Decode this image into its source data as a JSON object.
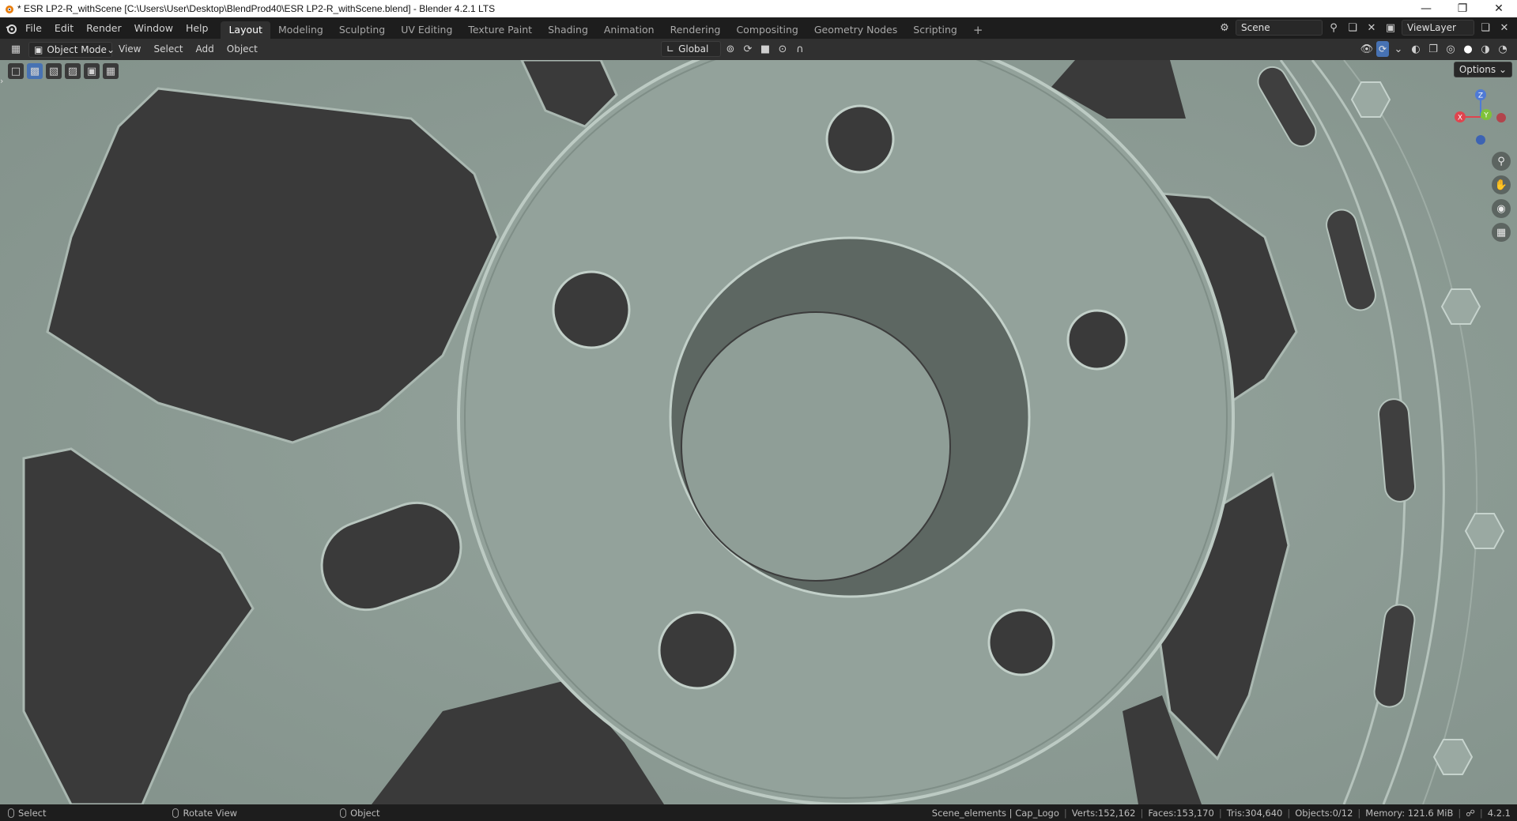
{
  "window": {
    "title": "* ESR LP2-R_withScene [C:\\Users\\User\\Desktop\\BlendProd40\\ESR LP2-R_withScene.blend] - Blender 4.2.1 LTS",
    "controls": [
      "minimize-icon",
      "restore-icon",
      "close-icon"
    ]
  },
  "menu": [
    "File",
    "Edit",
    "Render",
    "Window",
    "Help"
  ],
  "workspaces": [
    "Layout",
    "Modeling",
    "Sculpting",
    "UV Editing",
    "Texture Paint",
    "Shading",
    "Animation",
    "Rendering",
    "Compositing",
    "Geometry Nodes",
    "Scripting"
  ],
  "active_workspace": "Layout",
  "scene": {
    "name": "Scene",
    "view_layer": "ViewLayer"
  },
  "viewport_header": {
    "mode": "Object Mode",
    "menus": [
      "View",
      "Select",
      "Add",
      "Object"
    ],
    "transform_orientation": "Global",
    "options_label": "Options"
  },
  "gizmo": {
    "x": "X",
    "y": "Y",
    "z": "Z"
  },
  "status": {
    "select": "Select",
    "rotate": "Rotate View",
    "object": "Object",
    "collection": "Scene_elements | Cap_Logo",
    "verts": "Verts:152,162",
    "faces": "Faces:153,170",
    "tris": "Tris:304,640",
    "objects": "Objects:0/12",
    "memory": "Memory: 121.6 MiB",
    "version": "4.2.1"
  },
  "colors": {
    "accent": "#4772b3",
    "surface": "#8e9c96",
    "shadow": "#3a3a3a"
  }
}
